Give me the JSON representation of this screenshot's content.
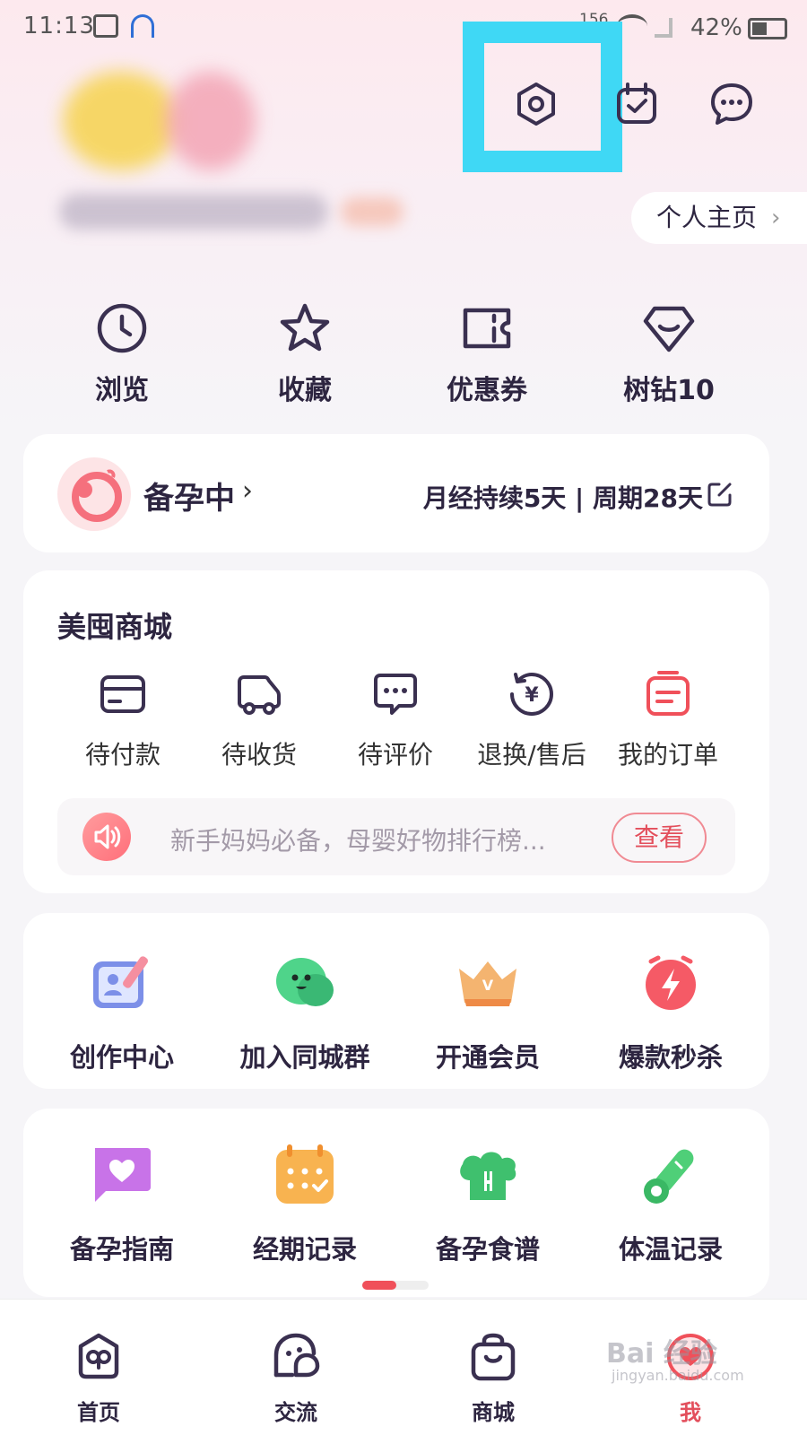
{
  "status": {
    "time": "11:13",
    "signal": "156",
    "battery": "42%"
  },
  "header": {
    "home_link": "个人主页"
  },
  "quick": [
    {
      "label": "浏览",
      "icon": "clock-icon"
    },
    {
      "label": "收藏",
      "icon": "star-icon"
    },
    {
      "label": "优惠券",
      "icon": "coupon-icon"
    },
    {
      "label": "树钻10",
      "icon": "diamond-icon"
    }
  ],
  "pregnancy": {
    "title": "备孕中",
    "info": "月经持续5天 | 周期28天"
  },
  "shop": {
    "title": "美囤商城",
    "orders": [
      {
        "label": "待付款",
        "icon": "card-icon"
      },
      {
        "label": "待收货",
        "icon": "truck-icon"
      },
      {
        "label": "待评价",
        "icon": "comment-icon"
      },
      {
        "label": "退换/售后",
        "icon": "refund-icon"
      },
      {
        "label": "我的订单",
        "icon": "order-icon"
      }
    ],
    "notice": "新手妈妈必备，母婴好物排行榜...",
    "notice_btn": "查看"
  },
  "features1": [
    {
      "label": "创作中心",
      "icon": "create-icon"
    },
    {
      "label": "加入同城群",
      "icon": "chat-bubble-icon"
    },
    {
      "label": "开通会员",
      "icon": "crown-icon"
    },
    {
      "label": "爆款秒杀",
      "icon": "lightning-clock-icon"
    }
  ],
  "features2": [
    {
      "label": "备孕指南",
      "icon": "heart-flag-icon"
    },
    {
      "label": "经期记录",
      "icon": "calendar-check-icon"
    },
    {
      "label": "备孕食谱",
      "icon": "chef-hat-icon"
    },
    {
      "label": "体温记录",
      "icon": "thermometer-icon"
    }
  ],
  "nav": [
    {
      "label": "首页",
      "icon": "home-icon"
    },
    {
      "label": "交流",
      "icon": "chat-icon"
    },
    {
      "label": "商城",
      "icon": "bag-icon"
    },
    {
      "label": "我",
      "icon": "me-icon"
    }
  ],
  "watermark": {
    "brand": "Bai 经验",
    "url": "jingyan.baidu.com"
  },
  "colors": {
    "accent": "#e34f5c",
    "highlight": "#3fd8f5"
  }
}
